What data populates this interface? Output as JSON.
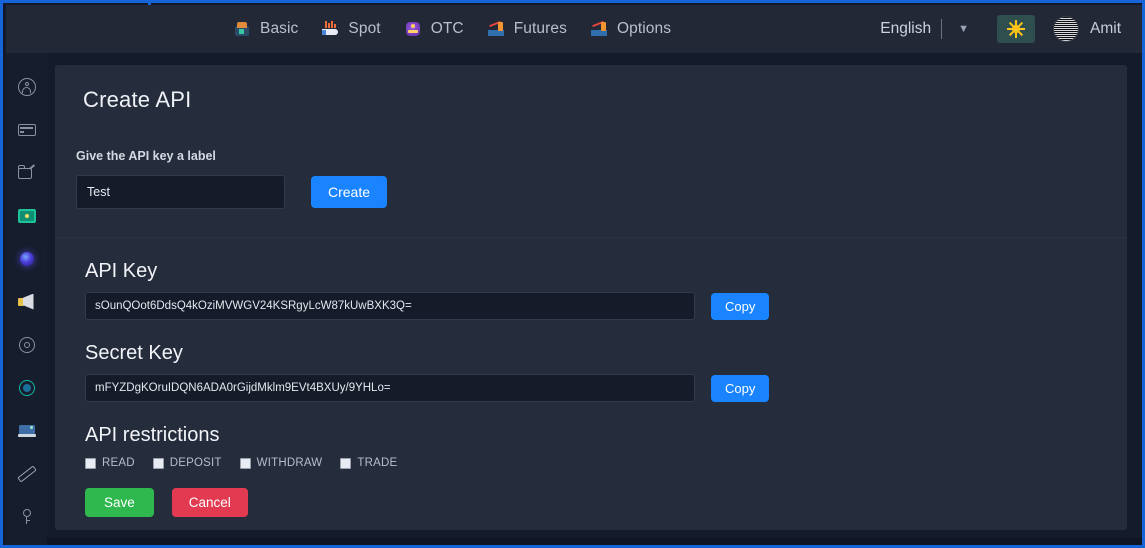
{
  "navbar": {
    "items": [
      {
        "label": "Basic",
        "icon": "basic-chart-icon"
      },
      {
        "label": "Spot",
        "icon": "spot-chart-icon"
      },
      {
        "label": "OTC",
        "icon": "otc-box-icon"
      },
      {
        "label": "Futures",
        "icon": "futures-chart-icon"
      },
      {
        "label": "Options",
        "icon": "options-chart-icon"
      }
    ],
    "language": "English",
    "language_caret": "▼",
    "theme_icon": "sun-icon",
    "user_name": "Amit",
    "avatar_icon": "user-avatar"
  },
  "sidebar": {
    "items": [
      {
        "icon": "user-circle-icon"
      },
      {
        "icon": "card-icon"
      },
      {
        "icon": "folder-export-icon"
      },
      {
        "icon": "wallet-icon"
      },
      {
        "icon": "orb-icon"
      },
      {
        "icon": "megaphone-icon"
      },
      {
        "icon": "gear-icon"
      },
      {
        "icon": "target-icon"
      },
      {
        "icon": "laptop-icon"
      },
      {
        "icon": "ruler-icon"
      },
      {
        "icon": "key-search-icon"
      }
    ]
  },
  "create_section": {
    "title": "Create API",
    "label_hint": "Give the API key a label",
    "label_value": "Test",
    "label_placeholder": "",
    "create_button": "Create"
  },
  "keys_section": {
    "api_key_heading": "API Key",
    "api_key_value": "sOunQOot6DdsQ4kOziMVWGV24KSRgyLcW87kUwBXK3Q=",
    "api_key_copy": "Copy",
    "secret_key_heading": "Secret Key",
    "secret_key_value": "mFYZDgKOruIDQN6ADA0rGijdMklm9EVt4BXUy/9YHLo=",
    "secret_key_copy": "Copy"
  },
  "restrictions": {
    "heading": "API restrictions",
    "options": [
      {
        "label": "READ",
        "checked": false
      },
      {
        "label": "DEPOSIT",
        "checked": false
      },
      {
        "label": "WITHDRAW",
        "checked": false
      },
      {
        "label": "TRADE",
        "checked": false
      }
    ]
  },
  "actions": {
    "save": "Save",
    "cancel": "Cancel"
  },
  "colors": {
    "accent_blue": "#1a84ff",
    "frame_blue": "#1565d8",
    "save_green": "#2eb84e",
    "cancel_red": "#e23b51",
    "card_bg": "#252c3b",
    "page_bg": "#141b2a",
    "navbar_bg": "#222836",
    "sidebar_bg": "#161d2c"
  }
}
